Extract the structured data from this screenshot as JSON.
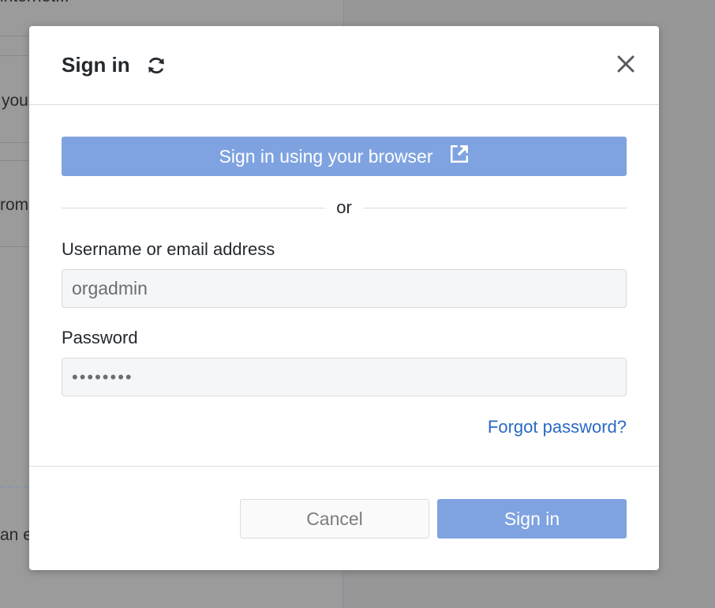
{
  "background": {
    "snippets": [
      "internet...",
      "you",
      "rom",
      "an e"
    ]
  },
  "dialog": {
    "title": "Sign in",
    "browser_button": "Sign in using your browser",
    "divider": "or",
    "username": {
      "label": "Username or email address",
      "value": "orgadmin"
    },
    "password": {
      "label": "Password",
      "value": "••••••••"
    },
    "forgot_link": "Forgot password?",
    "cancel_button": "Cancel",
    "signin_button": "Sign in"
  },
  "colors": {
    "primary": "#7fa3e0",
    "link": "#2a6ac4",
    "overlay": "#979797"
  },
  "icons": {
    "refresh": "refresh-icon",
    "close": "close-icon",
    "external": "external-link-icon"
  }
}
